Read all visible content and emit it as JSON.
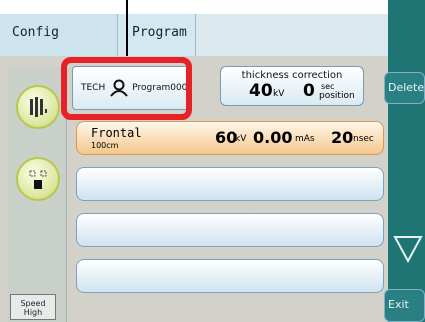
{
  "tabs": [
    {
      "label": "Config"
    },
    {
      "label": "Program"
    }
  ],
  "tech": {
    "label": "TECH",
    "program": "Program000"
  },
  "thickness": {
    "title": "thickness correction",
    "kv_value": "40",
    "kv_unit": "kV",
    "sec_value": "0",
    "sec_label": "sec",
    "position_label": "position"
  },
  "rows": [
    {
      "name": "Frontal",
      "distance": "100cm",
      "kv_value": "60",
      "kv_unit": "kV",
      "mas_value": "0.00",
      "mas_unit": "mAs",
      "nsec_value": "20",
      "nsec_unit": "nsec"
    }
  ],
  "speed": {
    "line1": "Speed",
    "line2": "High"
  },
  "side": {
    "delete_label": "Delete",
    "exit_label": "Exit"
  },
  "colors": {
    "accent_red": "#e62128",
    "active_row": "#f4c68c",
    "side_bar": "#1f7474"
  }
}
